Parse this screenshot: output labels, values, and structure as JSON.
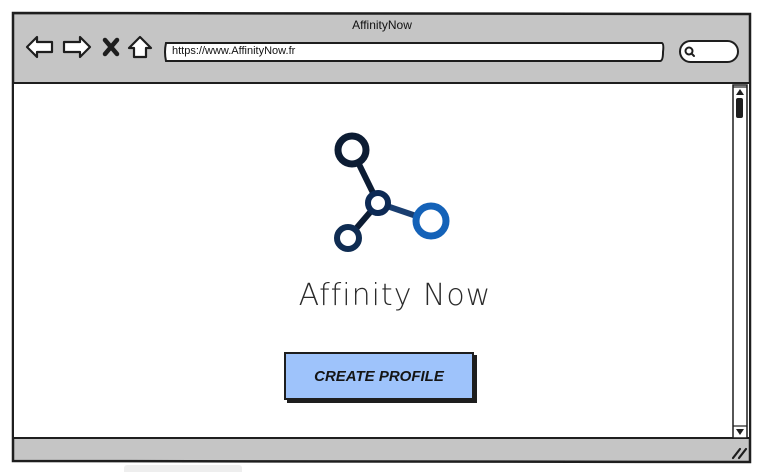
{
  "window": {
    "title": "AffinityNow"
  },
  "toolbar": {
    "back_icon": "back-arrow-icon",
    "forward_icon": "forward-arrow-icon",
    "stop_icon": "close-icon",
    "home_icon": "home-icon",
    "search_icon": "search-icon",
    "url": "https://www.AffinityNow.fr"
  },
  "main": {
    "logo_icon": "molecule-logo-icon",
    "brand_name": "Affinity Now",
    "create_profile_label": "CREATE PROFILE"
  },
  "colors": {
    "chrome_gray": "#c5c5c5",
    "button_blue": "#9ec3fb",
    "logo_dark": "#0c1c33",
    "logo_blue": "#1462b8"
  }
}
